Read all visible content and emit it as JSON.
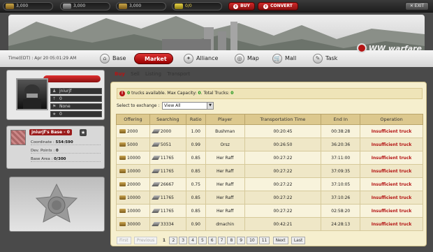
{
  "resources": [
    {
      "name": "gold-icon",
      "value": "3,000"
    },
    {
      "name": "fuel-icon",
      "value": "3,000"
    },
    {
      "name": "steel-icon",
      "value": "3,000"
    },
    {
      "name": "oil-icon",
      "value": "0/0"
    }
  ],
  "buttons": {
    "buy": "BUY",
    "convert": "CONVERT",
    "exit": "EXIT"
  },
  "time": "Time(EDT) : Apr 20 05:01:29 AM",
  "nav": [
    "Base",
    "Market",
    "Alliance",
    "Map",
    "Mall",
    "Task"
  ],
  "logo": "WW  warfare",
  "profile": {
    "name": "jniurjf",
    "val1": "0",
    "alliance": "None",
    "val2": "0"
  },
  "base": {
    "title": "jniurjf's Base - 0",
    "coordinate_label": "Coordinate : ",
    "coordinate": "554:590",
    "dev_label": "Dev. Points : ",
    "dev": "0",
    "area_label": "Base Area : ",
    "area": "0/300"
  },
  "tabs": [
    "Buy",
    "Sell",
    "Listing",
    "Transport"
  ],
  "info": {
    "available": "0",
    "available_text": " trucks available. Max Capacity: ",
    "max": "0",
    "total_text": ". Total Trucks: ",
    "total": "0"
  },
  "select": {
    "label": "Select to exchange :",
    "value": "View All"
  },
  "columns": [
    "Offering",
    "Searching",
    "Ratio",
    "Player",
    "Transportation Time",
    "End In",
    "Operation"
  ],
  "rows": [
    [
      "2000",
      "2000",
      "1.00",
      "Bushman",
      "00:20:45",
      "00:38:28",
      "Insufficient truck"
    ],
    [
      "5000",
      "5051",
      "0.99",
      "Orsz",
      "00:26:50",
      "36:20:36",
      "Insufficient truck"
    ],
    [
      "10000",
      "11765",
      "0.85",
      "Her Raff",
      "00:27:22",
      "37:11:00",
      "Insufficient truck"
    ],
    [
      "10000",
      "11765",
      "0.85",
      "Her Raff",
      "00:27:22",
      "37:09:35",
      "Insufficient truck"
    ],
    [
      "20000",
      "26667",
      "0.75",
      "Her Raff",
      "00:27:22",
      "37:10:05",
      "Insufficient truck"
    ],
    [
      "10000",
      "11765",
      "0.85",
      "Her Raff",
      "00:27:22",
      "37:10:26",
      "Insufficient truck"
    ],
    [
      "10000",
      "11765",
      "0.85",
      "Her Raff",
      "00:27:22",
      "02:58:20",
      "Insufficient truck"
    ],
    [
      "30000",
      "33334",
      "0.90",
      "dmachin",
      "00:42:21",
      "24:28:13",
      "Insufficient truck"
    ]
  ],
  "pager": {
    "first": "First",
    "prev": "Previous",
    "pages": [
      "1",
      "2",
      "3",
      "4",
      "5",
      "6",
      "7",
      "8",
      "9",
      "10",
      "11"
    ],
    "next": "Next",
    "last": "Last"
  }
}
